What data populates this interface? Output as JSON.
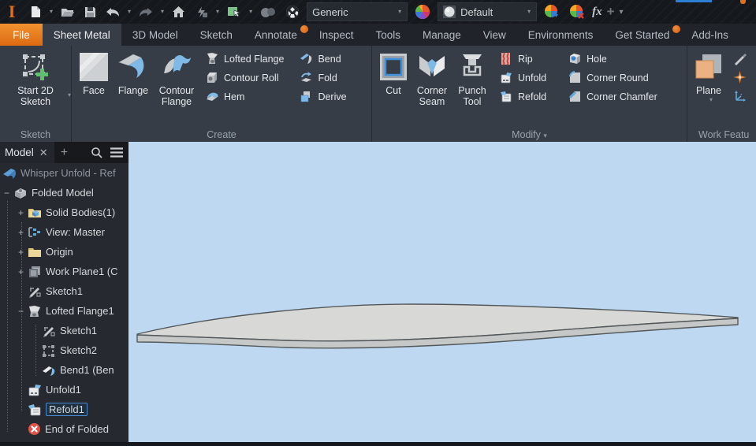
{
  "titlebar": {
    "material_value": "Generic",
    "appearance_value": "Default",
    "fx_label": "fx"
  },
  "tabs": [
    {
      "label": "File"
    },
    {
      "label": "Sheet Metal"
    },
    {
      "label": "3D Model"
    },
    {
      "label": "Sketch"
    },
    {
      "label": "Annotate",
      "dot": true
    },
    {
      "label": "Inspect"
    },
    {
      "label": "Tools"
    },
    {
      "label": "Manage"
    },
    {
      "label": "View"
    },
    {
      "label": "Environments"
    },
    {
      "label": "Get Started",
      "dot": true
    },
    {
      "label": "Add-Ins"
    }
  ],
  "ribbon": {
    "sketch": {
      "label": "Sketch",
      "start_button": "Start 2D Sketch"
    },
    "create": {
      "label": "Create",
      "large": [
        "Face",
        "Flange",
        "Contour Flange"
      ],
      "small": [
        "Lofted Flange",
        "Contour Roll",
        "Hem",
        "Bend",
        "Fold",
        "Derive"
      ]
    },
    "modify": {
      "label": "Modify",
      "large": [
        "Cut",
        "Corner Seam",
        "Punch Tool"
      ],
      "small": [
        "Rip",
        "Unfold",
        "Refold",
        "Hole",
        "Corner Round",
        "Corner Chamfer"
      ]
    },
    "work": {
      "label": "Work Featu",
      "large": [
        "Plane"
      ]
    }
  },
  "browser": {
    "tab_label": "Model",
    "items": [
      {
        "label": "Whisper Unfold - Ref",
        "icon": "part-document-icon"
      },
      {
        "label": "Folded Model",
        "icon": "folded-model-icon",
        "exp": "minus"
      },
      {
        "label": "Solid Bodies(1)",
        "icon": "solid-bodies-folder-icon",
        "exp": "plus"
      },
      {
        "label": "View: Master",
        "icon": "view-representation-icon",
        "exp": "plus"
      },
      {
        "label": "Origin",
        "icon": "origin-folder-icon",
        "exp": "plus"
      },
      {
        "label": "Work Plane1 (C",
        "icon": "work-plane-icon",
        "exp": "plus"
      },
      {
        "label": "Sketch1",
        "icon": "sketch-icon"
      },
      {
        "label": "Lofted Flange1",
        "icon": "lofted-flange-icon",
        "exp": "minus"
      },
      {
        "label": "Sketch1",
        "icon": "sketch-icon"
      },
      {
        "label": "Sketch2",
        "icon": "sketch-icon"
      },
      {
        "label": "Bend1 (Ben",
        "icon": "bend-feature-icon"
      },
      {
        "label": "Unfold1",
        "icon": "unfold-feature-icon"
      },
      {
        "label": "Refold1",
        "icon": "refold-feature-icon",
        "selected": true
      },
      {
        "label": "End of Folded",
        "icon": "end-of-folded-icon"
      }
    ]
  },
  "viewport": {
    "background_color": "#BED8F1",
    "part_top_color": "#D8D9D6",
    "part_side_color": "#C5C8C6",
    "part_edge_color": "#53585B",
    "part_description": "curved sheet metal lofted flange part"
  }
}
